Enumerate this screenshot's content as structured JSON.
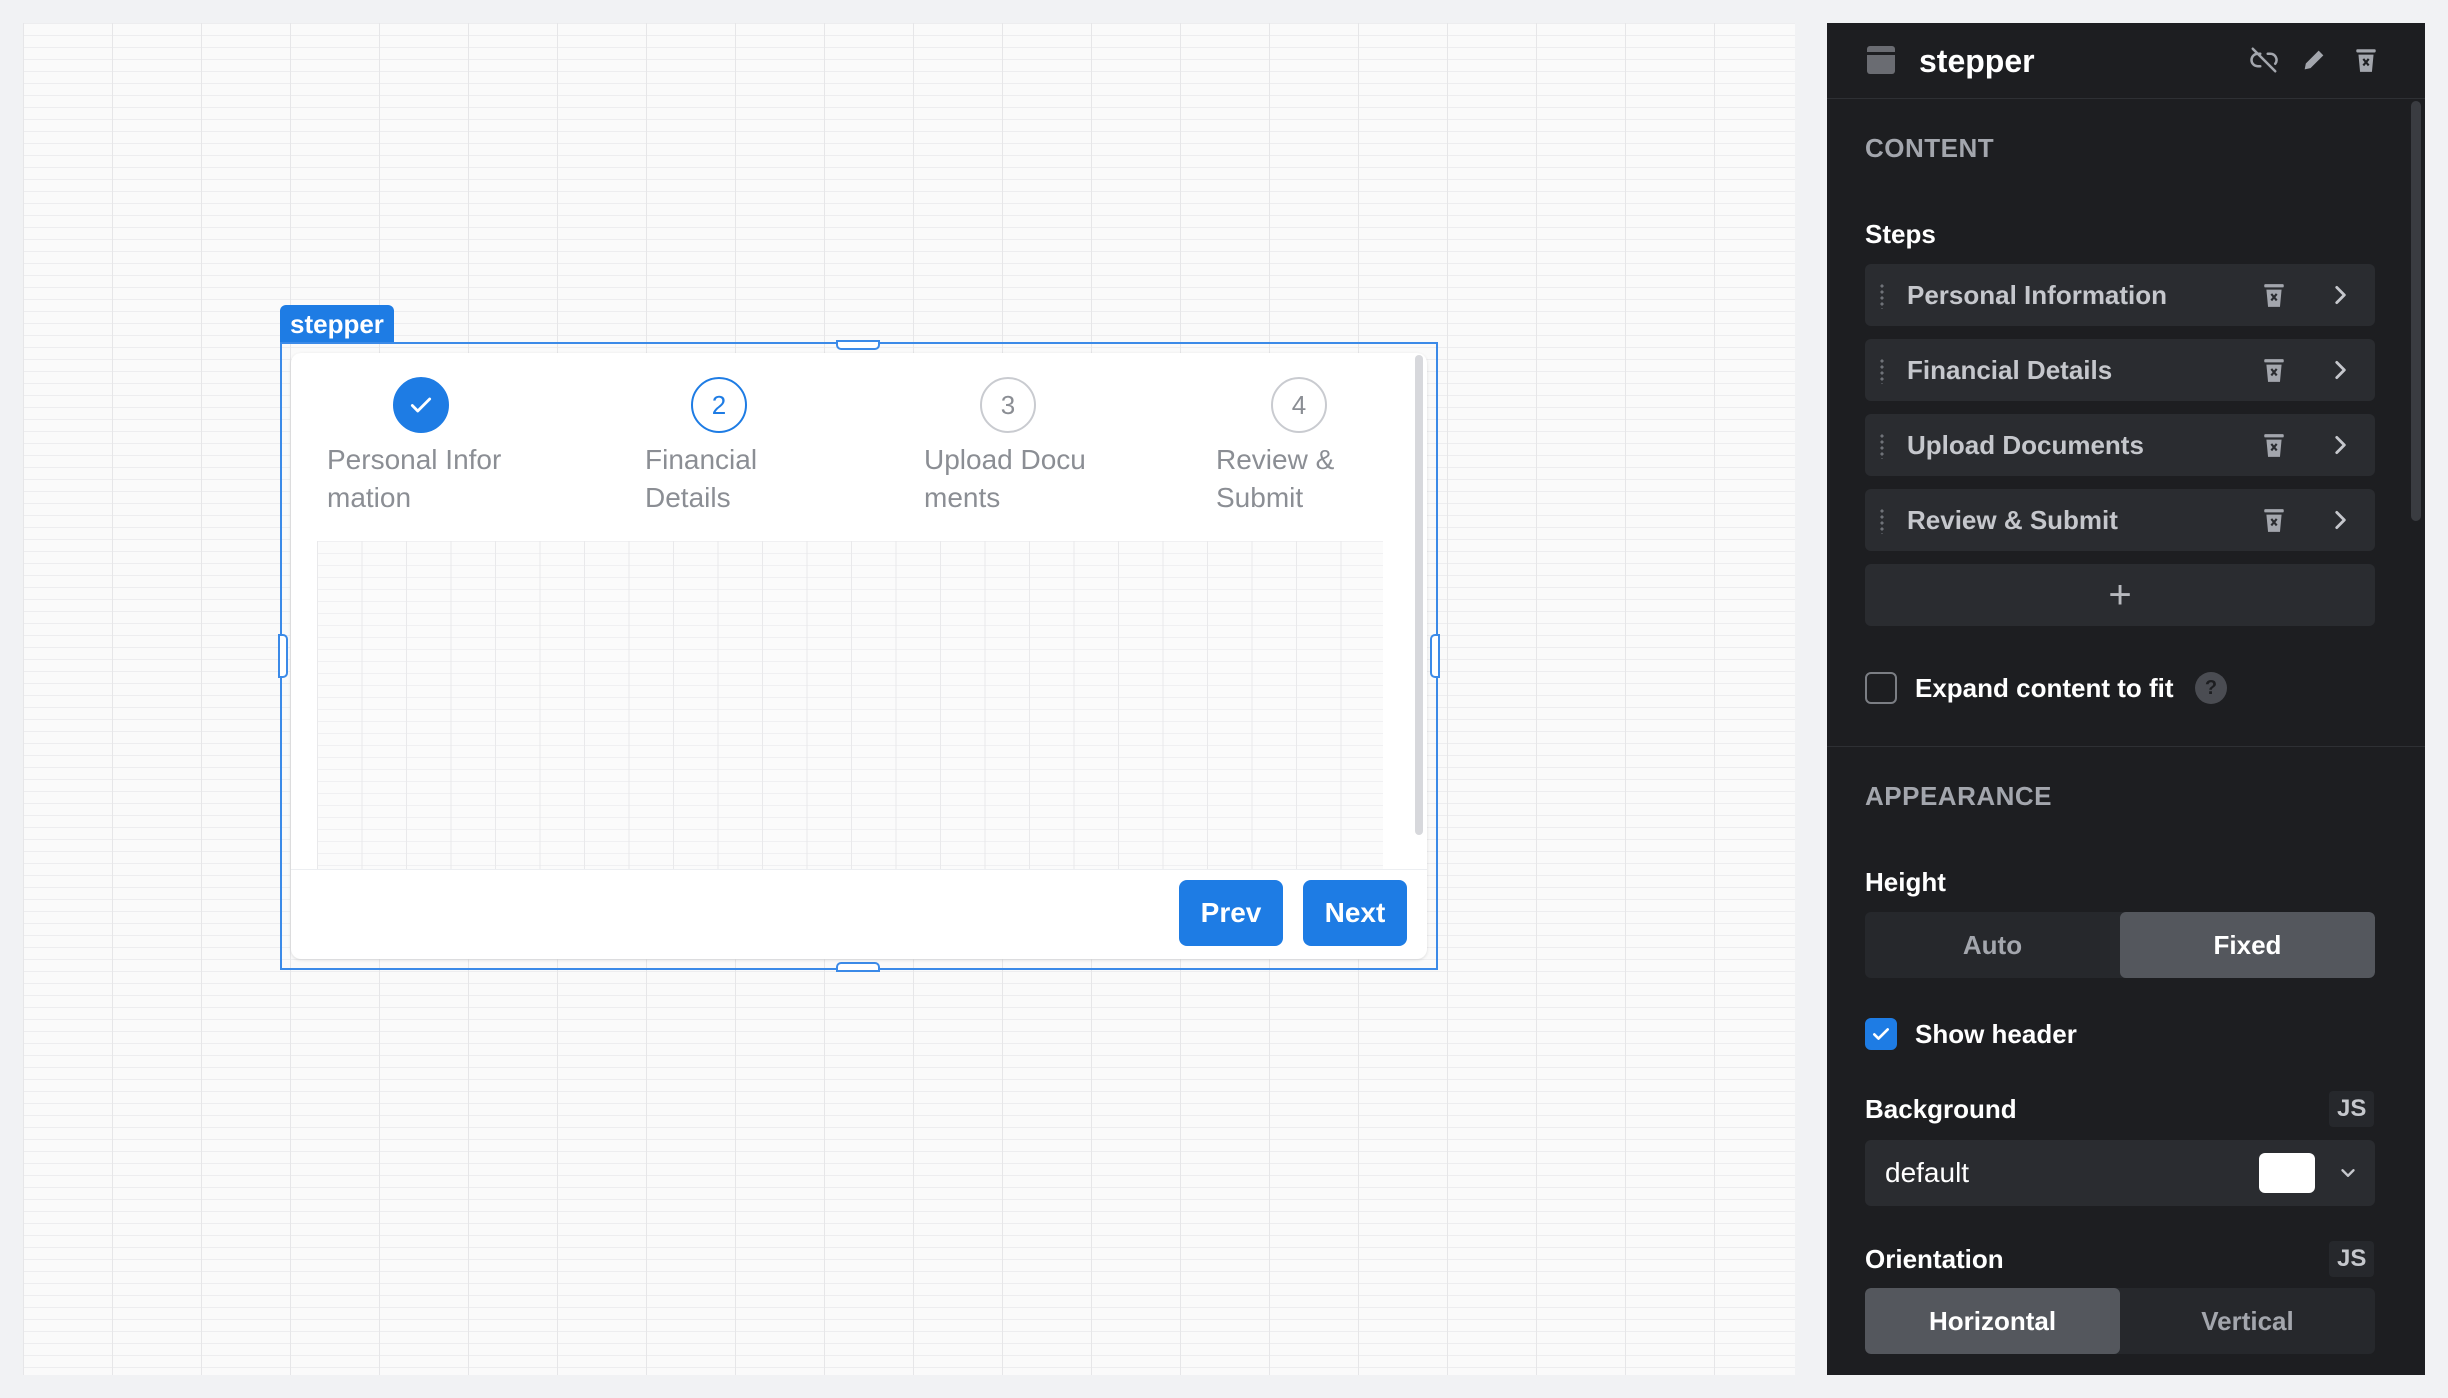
{
  "canvas": {
    "selection_tag": "stepper",
    "stepper": {
      "steps": [
        {
          "index": "1",
          "label": "Personal Information",
          "state": "completed"
        },
        {
          "index": "2",
          "label": "Financial Details",
          "state": "current"
        },
        {
          "index": "3",
          "label": "Upload Documents",
          "state": "upcoming"
        },
        {
          "index": "4",
          "label": "Review & Submit",
          "state": "upcoming"
        }
      ],
      "prev_label": "Prev",
      "next_label": "Next"
    }
  },
  "panel": {
    "title": "stepper",
    "content_section": "CONTENT",
    "steps_label": "Steps",
    "steps": [
      {
        "label": "Personal Information"
      },
      {
        "label": "Financial Details"
      },
      {
        "label": "Upload Documents"
      },
      {
        "label": "Review & Submit"
      }
    ],
    "add_step": "+",
    "expand_content": {
      "label": "Expand content to fit",
      "checked": false
    },
    "help_glyph": "?",
    "appearance_section": "APPEARANCE",
    "height": {
      "label": "Height",
      "options": [
        "Auto",
        "Fixed"
      ],
      "selected": "Fixed"
    },
    "show_header": {
      "label": "Show header",
      "checked": true
    },
    "background": {
      "label": "Background",
      "js": "JS",
      "value": "default",
      "swatch": "#ffffff"
    },
    "orientation": {
      "label": "Orientation",
      "js": "JS",
      "options": [
        "Horizontal",
        "Vertical"
      ],
      "selected": "Horizontal"
    }
  },
  "colors": {
    "accent": "#1e7ce4",
    "panel_bg": "#1d1e21"
  }
}
